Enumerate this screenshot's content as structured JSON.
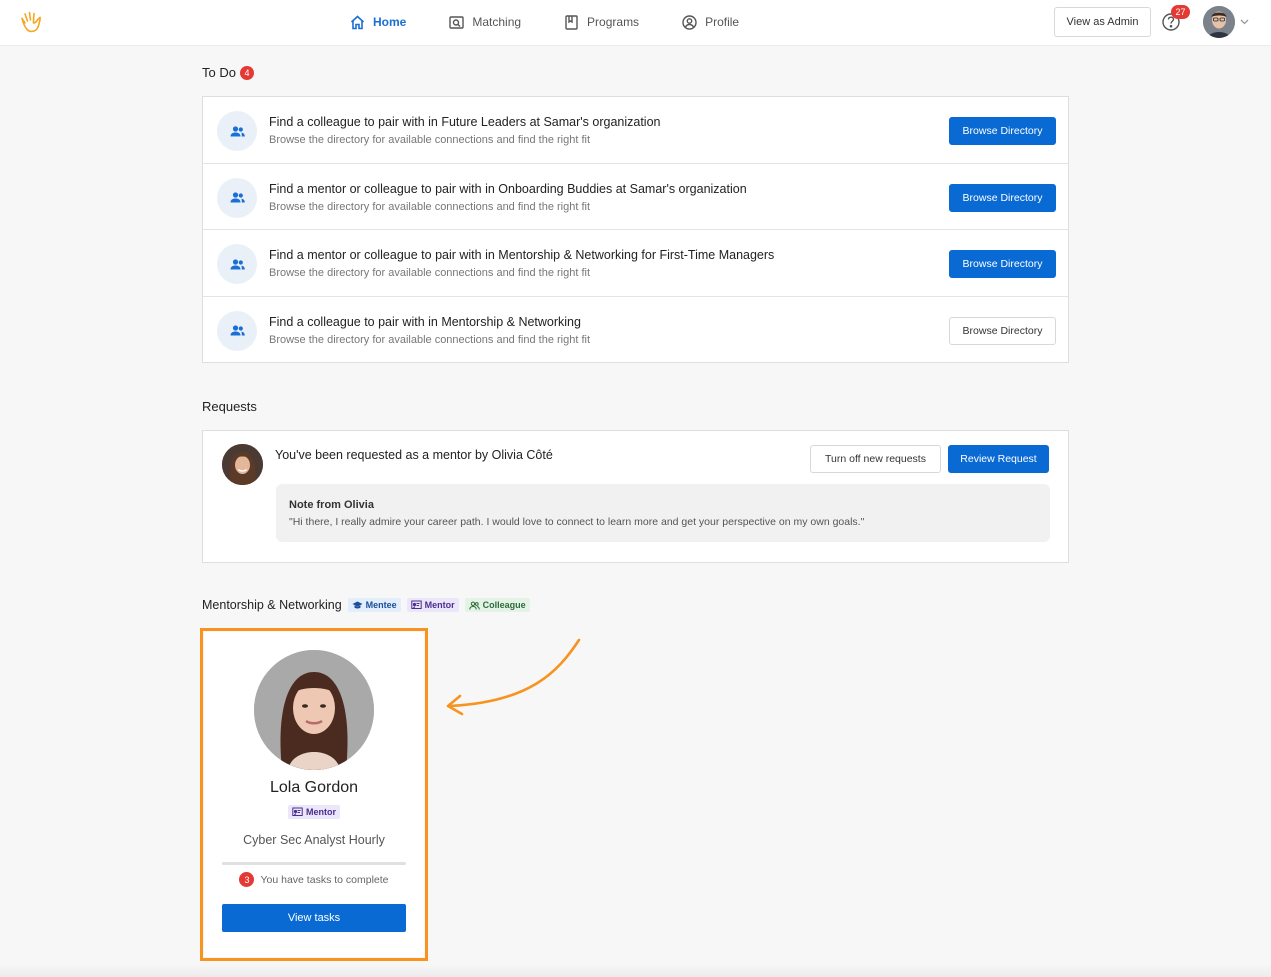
{
  "nav": {
    "items": [
      {
        "label": "Home",
        "icon": "home-icon",
        "active": true
      },
      {
        "label": "Matching",
        "icon": "matching-icon",
        "active": false
      },
      {
        "label": "Programs",
        "icon": "book-icon",
        "active": false
      },
      {
        "label": "Profile",
        "icon": "user-circle-icon",
        "active": false
      }
    ],
    "view_as_admin": "View as Admin",
    "notification_count": "27"
  },
  "todo": {
    "title": "To Do",
    "count": "4",
    "items": [
      {
        "title": "Find a colleague to pair with in Future Leaders at Samar's organization",
        "subtitle": "Browse the directory for available connections and find the right fit",
        "button": "Browse Directory",
        "style": "primary"
      },
      {
        "title": "Find a mentor or colleague to pair with in Onboarding Buddies at Samar's organization",
        "subtitle": "Browse the directory for available connections and find the right fit",
        "button": "Browse Directory",
        "style": "primary"
      },
      {
        "title": "Find a mentor or colleague to pair with in Mentorship & Networking for First-Time Managers",
        "subtitle": "Browse the directory for available connections and find the right fit",
        "button": "Browse Directory",
        "style": "primary"
      },
      {
        "title": "Find a colleague to pair with in Mentorship & Networking",
        "subtitle": "Browse the directory for available connections and find the right fit",
        "button": "Browse Directory",
        "style": "secondary"
      }
    ]
  },
  "requests": {
    "title": "Requests",
    "item": {
      "text": "You've been requested as a mentor by Olivia Côté",
      "turn_off_label": "Turn off new requests",
      "review_label": "Review Request",
      "note_title": "Note from Olivia",
      "note_text": "\"Hi there, I really admire your career path. I would love to connect to learn more and get your perspective on my own goals.\""
    }
  },
  "program": {
    "title": "Mentorship & Networking",
    "tags": [
      {
        "label": "Mentee",
        "icon": "graduation-cap-icon"
      },
      {
        "label": "Mentor",
        "icon": "presentation-icon"
      },
      {
        "label": "Colleague",
        "icon": "users-icon"
      }
    ],
    "card": {
      "name": "Lola Gordon",
      "role_tag": "Mentor",
      "job_title": "Cyber Sec Analyst Hourly",
      "task_count": "3",
      "task_text": "You have tasks to complete",
      "button": "View tasks"
    }
  },
  "colors": {
    "accent": "#0a6ad4",
    "badge": "#e53935",
    "highlight": "#f7931e"
  }
}
